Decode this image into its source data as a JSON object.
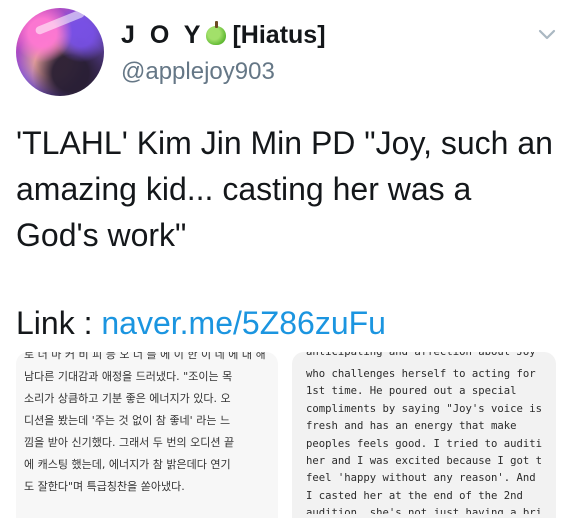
{
  "author": {
    "display_name": "J O Y",
    "name_suffix": "[Hiatus]",
    "handle": "@applejoy903",
    "name_icon": "green-apple-icon",
    "avatar_icon": "profile-avatar",
    "menu_icon": "chevron-down-icon"
  },
  "tweet": {
    "text": "'TLAHL' Kim Jin Min PD \"Joy, such an amazing kid... casting her was a God's work\"",
    "link_label": "Link : ",
    "link_text": "naver.me/5Z86zuFu"
  },
  "media_left": {
    "top_clipped": "로 더 마 커 비 피 등 오 너 를 에 이 한 이 네 에 대 해",
    "lines": [
      "남다른 기대감과 애정을 드러냈다. \"조이는 목",
      "소리가 상큼하고 기분 좋은 에너지가 있다. 오",
      "디션을 봤는데 '주는 것 없이 참 좋네' 라는 느",
      "낌을 받아 신기했다. 그래서 두 번의 오디션 끝",
      "에 캐스팅 했는데, 에너지가 참 밝은데다 연기",
      "도 잘한다\"며 특급칭찬을 쏟아냈다."
    ]
  },
  "media_right": {
    "top_clipped": "anticipating and affection about Joy",
    "lines": [
      "who challenges herself to acting for the",
      "1st time. He poured out a special",
      "compliments by saying \"Joy's voice is",
      "fresh and has an energy that make",
      "peoples feels good. I tried to auditioned",
      "her and I was excited because I got to",
      "feel 'happy without any reason'. And so,",
      "I casted her at the end of the 2nd"
    ],
    "bottom_clipped": "audition, she's not just having a bright"
  },
  "colors": {
    "link": "#1b95e0",
    "text": "#14171a",
    "secondary": "#657786",
    "apple_green": "#5fb832"
  }
}
